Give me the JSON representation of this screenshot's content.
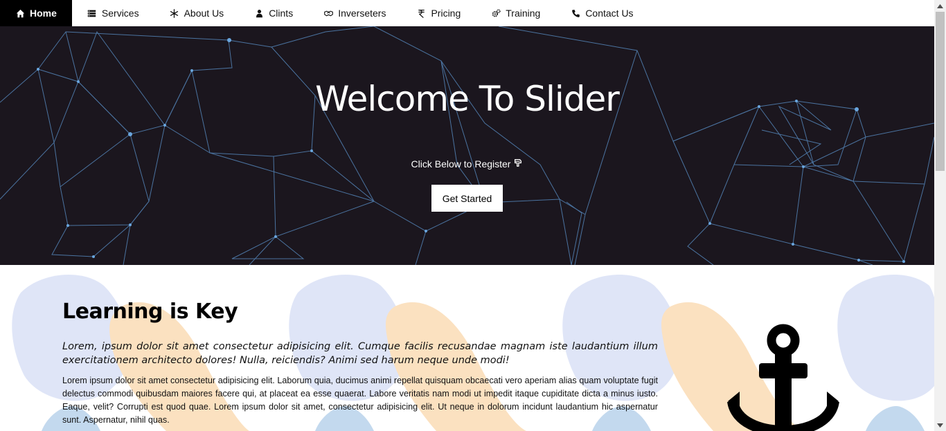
{
  "nav": {
    "items": [
      {
        "label": "Home",
        "icon": "home-icon",
        "active": true
      },
      {
        "label": "Services",
        "icon": "server-icon",
        "active": false
      },
      {
        "label": "About Us",
        "icon": "snowflake-icon",
        "active": false
      },
      {
        "label": "Clints",
        "icon": "user-icon",
        "active": false
      },
      {
        "label": "Inverseters",
        "icon": "handshake-icon",
        "active": false
      },
      {
        "label": "Pricing",
        "icon": "rupee-icon",
        "active": false
      },
      {
        "label": "Training",
        "icon": "cogs-icon",
        "active": false
      },
      {
        "label": "Contact Us",
        "icon": "phone-icon",
        "active": false
      }
    ]
  },
  "hero": {
    "title": "Welcome To Slider",
    "subtitle": "Click Below to Register",
    "subtitle_icon": "hand-point-down-icon",
    "cta": "Get Started",
    "background_color": "#1b161e",
    "line_color": "#5b93cc"
  },
  "section": {
    "title": "Learning is Key",
    "lead": "Lorem, ipsum dolor sit amet consectetur adipisicing elit. Cumque facilis recusandae magnam iste laudantium illum exercitationem architecto dolores! Nulla, reiciendis? Animi sed harum neque unde modi!",
    "body": "Lorem ipsum dolor sit amet consectetur adipisicing elit. Laborum quia, ducimus animi repellat quisquam obcaecati vero aperiam alias quam voluptate fugit delectus commodi quibusdam maiores facere qui, at placeat ea esse quaerat. Labore veritatis nam modi ut impedit itaque cupiditate dicta a minus iusto. Eaque, velit? Corrupti est quod quae. Lorem ipsum dolor sit amet, consectetur adipisicing elit. Ut neque in dolorum incidunt laudantium hic aspernatur sunt. Aspernatur, nihil quas.",
    "illustration_icon": "anchor-icon",
    "blob_colors": [
      "#dfe5f7",
      "#fbe1c0",
      "#c3d9ee"
    ]
  }
}
